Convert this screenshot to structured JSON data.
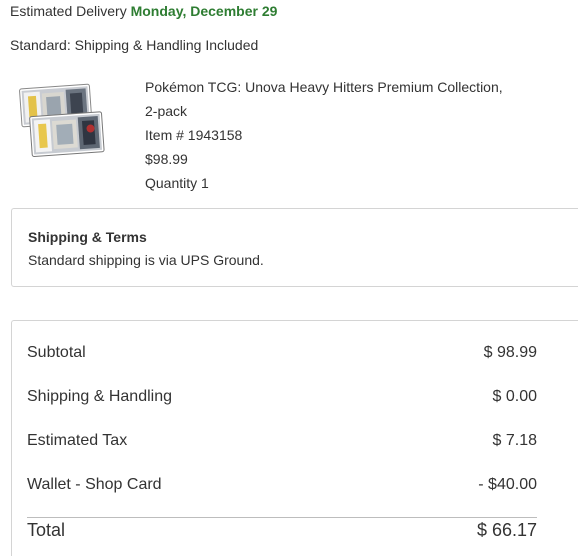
{
  "delivery": {
    "label": "Estimated Delivery",
    "date": "Monday, December 29"
  },
  "shipping_method": "Standard: Shipping & Handling Included",
  "product": {
    "title_line1": "Pokémon TCG: Unova Heavy Hitters Premium Collection,",
    "title_line2": "2-pack",
    "item_number": "Item # 1943158",
    "price": "$98.99",
    "quantity": "Quantity 1"
  },
  "terms": {
    "title": "Shipping & Terms",
    "text": "Standard shipping is via UPS Ground."
  },
  "summary": {
    "subtotal_label": "Subtotal",
    "subtotal_value": "$ 98.99",
    "shipping_label": "Shipping & Handling",
    "shipping_value": "$ 0.00",
    "tax_label": "Estimated Tax",
    "tax_value": "$ 7.18",
    "wallet_label": "Wallet - Shop Card",
    "wallet_value": "- $40.00",
    "total_label": "Total",
    "total_value": "$ 66.17"
  },
  "colors": {
    "delivery_date": "#2e7d32",
    "text": "#333333",
    "border": "#d4d4d4"
  }
}
